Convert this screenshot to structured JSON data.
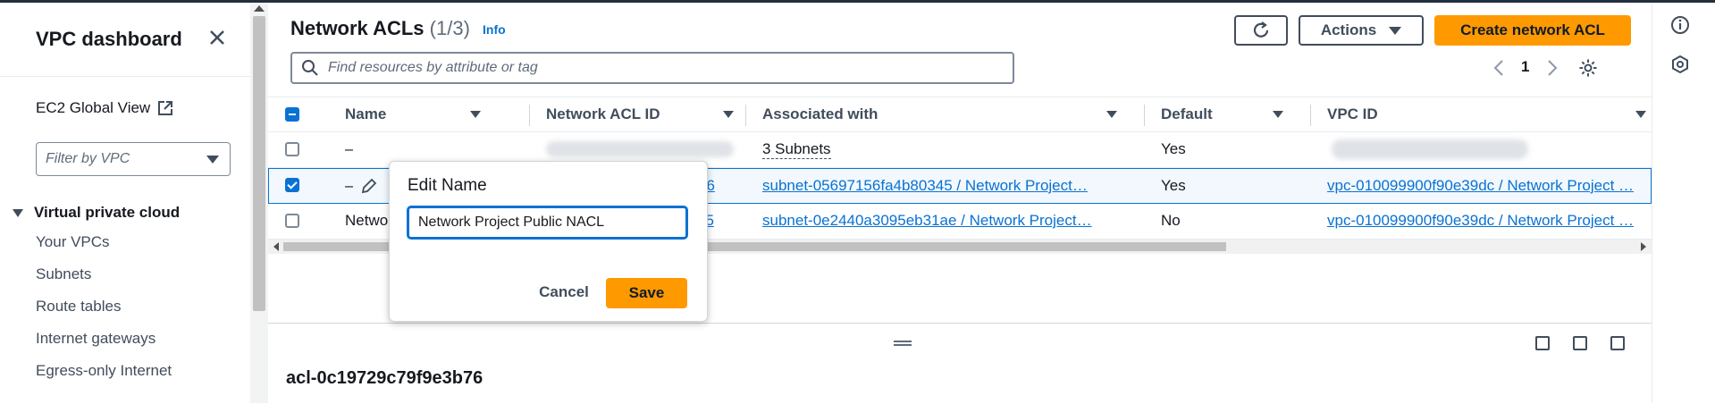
{
  "sidebar": {
    "title": "VPC dashboard",
    "ec2_global_view": "EC2 Global View",
    "filter_placeholder": "Filter by VPC",
    "section": "Virtual private cloud",
    "items": [
      {
        "label": "Your VPCs"
      },
      {
        "label": "Subnets"
      },
      {
        "label": "Route tables"
      },
      {
        "label": "Internet gateways"
      },
      {
        "label": "Egress-only Internet"
      }
    ]
  },
  "header": {
    "title": "Network ACLs",
    "count": "(1/3)",
    "info": "Info",
    "actions": "Actions",
    "create": "Create network ACL"
  },
  "search": {
    "placeholder": "Find resources by attribute or tag"
  },
  "pagination": {
    "page": "1"
  },
  "table": {
    "columns": [
      "Name",
      "Network ACL ID",
      "Associated with",
      "Default",
      "VPC ID"
    ],
    "rows": [
      {
        "name": "–",
        "acl_id": "",
        "associated": "3 Subnets",
        "default": "Yes",
        "vpc": "",
        "checked": false
      },
      {
        "name": "–",
        "acl_id": "76",
        "associated": "subnet-05697156fa4b80345 / Network Project…",
        "default": "Yes",
        "vpc": "vpc-010099900f90e39dc / Network Project …",
        "checked": true
      },
      {
        "name": "Netwo",
        "acl_id": "25",
        "associated": "subnet-0e2440a3095eb31ae / Network Project…",
        "default": "No",
        "vpc": "vpc-010099900f90e39dc / Network Project …",
        "checked": false
      }
    ]
  },
  "popover": {
    "title": "Edit Name",
    "value": "Network Project Public NACL",
    "cancel": "Cancel",
    "save": "Save"
  },
  "split_panel": {
    "title": "acl-0c19729c79f9e3b76"
  },
  "colors": {
    "accent": "#0972d3",
    "primary_button": "#ff9900",
    "nav_bar": "#232f3e"
  }
}
